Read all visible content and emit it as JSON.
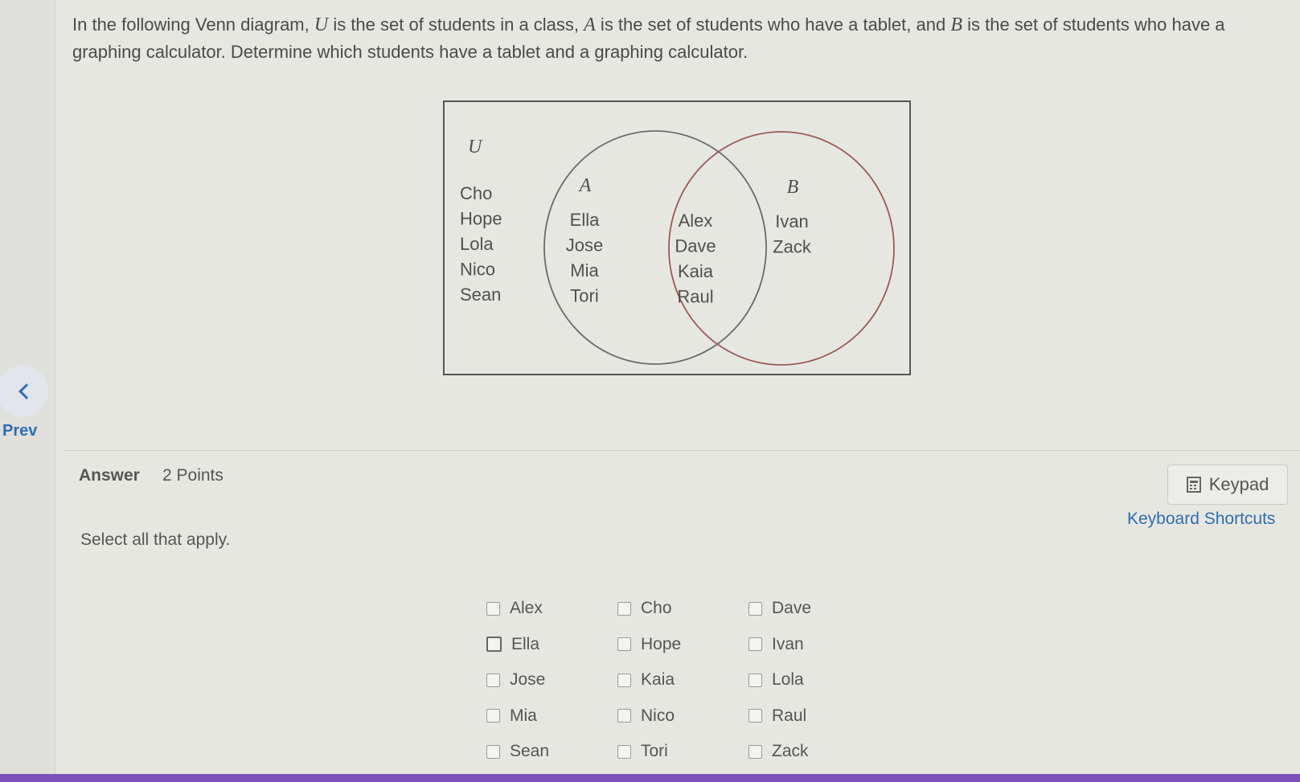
{
  "question": {
    "p1": "In the following Venn diagram, ",
    "u": "U",
    "p2": " is the set of students in a class, ",
    "a": "A",
    "p3": " is the set of students who have a tablet, and ",
    "b": "B",
    "p4": " is the set of students who have a graphing calculator. Determine which students have a tablet and a graphing calculator."
  },
  "venn": {
    "universe_label": "U",
    "set_a_label": "A",
    "set_b_label": "B",
    "outside": [
      "Cho",
      "Hope",
      "Lola",
      "Nico",
      "Sean"
    ],
    "only_a": [
      "Ella",
      "Jose",
      "Mia",
      "Tori"
    ],
    "both": [
      "Alex",
      "Dave",
      "Kaia",
      "Raul"
    ],
    "only_b": [
      "Ivan",
      "Zack"
    ],
    "colors": {
      "frame": "#555555",
      "circle_a": "#6a6a6a",
      "circle_b": "#9a5a55"
    }
  },
  "nav": {
    "prev_label": "Prev",
    "prev_icon": "chevron-left-icon"
  },
  "answer": {
    "label": "Answer",
    "points": "2 Points",
    "instruction": "Select all that apply."
  },
  "tools": {
    "keypad_label": "Keypad",
    "keypad_icon": "calculator-icon",
    "shortcuts_label": "Keyboard Shortcuts"
  },
  "options": [
    {
      "label": "Alex",
      "checked": false
    },
    {
      "label": "Ella",
      "checked": false
    },
    {
      "label": "Jose",
      "checked": false
    },
    {
      "label": "Mia",
      "checked": false
    },
    {
      "label": "Sean",
      "checked": false
    },
    {
      "label": "Cho",
      "checked": false
    },
    {
      "label": "Hope",
      "checked": false
    },
    {
      "label": "Kaia",
      "checked": false
    },
    {
      "label": "Nico",
      "checked": false
    },
    {
      "label": "Tori",
      "checked": false
    },
    {
      "label": "Dave",
      "checked": false
    },
    {
      "label": "Ivan",
      "checked": false
    },
    {
      "label": "Lola",
      "checked": false
    },
    {
      "label": "Raul",
      "checked": false
    },
    {
      "label": "Zack",
      "checked": false
    }
  ],
  "theme": {
    "accent": "#2f6db6",
    "bottom_bar": "#7d4fb8"
  }
}
